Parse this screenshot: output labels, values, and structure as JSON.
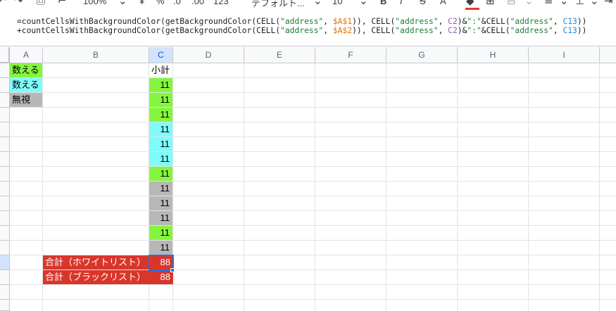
{
  "toolbar": {
    "zoom": "100%",
    "decimal_decrease": ".0",
    "decimal_increase": ".00",
    "number_format": "123",
    "font_name": "デフォルト...",
    "font_size": "10",
    "bold": "B",
    "italic": "I",
    "strikethrough": "S",
    "text_color": "A",
    "text_color_value": "#e53935"
  },
  "formula_bar": {
    "line1": [
      {
        "t": "=countCellsWithBackgroundColor(getBackgroundColor(CELL(",
        "k": ""
      },
      {
        "t": "\"address\"",
        "k": "s"
      },
      {
        "t": ", ",
        "k": ""
      },
      {
        "t": "$A$1",
        "k": "ra"
      },
      {
        "t": ")), CELL(",
        "k": ""
      },
      {
        "t": "\"address\"",
        "k": "s"
      },
      {
        "t": ", ",
        "k": ""
      },
      {
        "t": "C2",
        "k": "rc"
      },
      {
        "t": ")&",
        "k": ""
      },
      {
        "t": "\":\"",
        "k": "s"
      },
      {
        "t": "&CELL(",
        "k": ""
      },
      {
        "t": "\"address\"",
        "k": "s"
      },
      {
        "t": ", ",
        "k": ""
      },
      {
        "t": "C13",
        "k": "rd"
      },
      {
        "t": "))",
        "k": ""
      }
    ],
    "line2": [
      {
        "t": "+countCellsWithBackgroundColor(getBackgroundColor(CELL(",
        "k": ""
      },
      {
        "t": "\"address\"",
        "k": "s"
      },
      {
        "t": ", ",
        "k": ""
      },
      {
        "t": "$A$2",
        "k": "ra"
      },
      {
        "t": ")), CELL(",
        "k": ""
      },
      {
        "t": "\"address\"",
        "k": "s"
      },
      {
        "t": ", ",
        "k": ""
      },
      {
        "t": "C2",
        "k": "rc"
      },
      {
        "t": ")&",
        "k": ""
      },
      {
        "t": "\":\"",
        "k": "s"
      },
      {
        "t": "&CELL(",
        "k": ""
      },
      {
        "t": "\"address\"",
        "k": "s"
      },
      {
        "t": ", ",
        "k": ""
      },
      {
        "t": "C13",
        "k": "rd"
      },
      {
        "t": "))",
        "k": ""
      }
    ]
  },
  "columns": [
    "A",
    "B",
    "C",
    "D",
    "E",
    "F",
    "G",
    "H",
    "I"
  ],
  "cells": {
    "a1": "数える",
    "a2": "数える",
    "a3": "無視",
    "c1": "小計",
    "subtotals": [
      "11",
      "11",
      "11",
      "11",
      "11",
      "11",
      "11",
      "11",
      "11",
      "11",
      "11",
      "11"
    ],
    "whitelist_label": "合計（ホワイトリスト）",
    "whitelist_total": "88",
    "blacklist_label": "合計（ブラックリスト）",
    "blacklist_total": "88"
  },
  "colors": {
    "green": "#86f53f",
    "cyan": "#80fbfb",
    "gray": "#b7b7b7",
    "red": "#d9362b",
    "selection": "#1a73e8"
  }
}
